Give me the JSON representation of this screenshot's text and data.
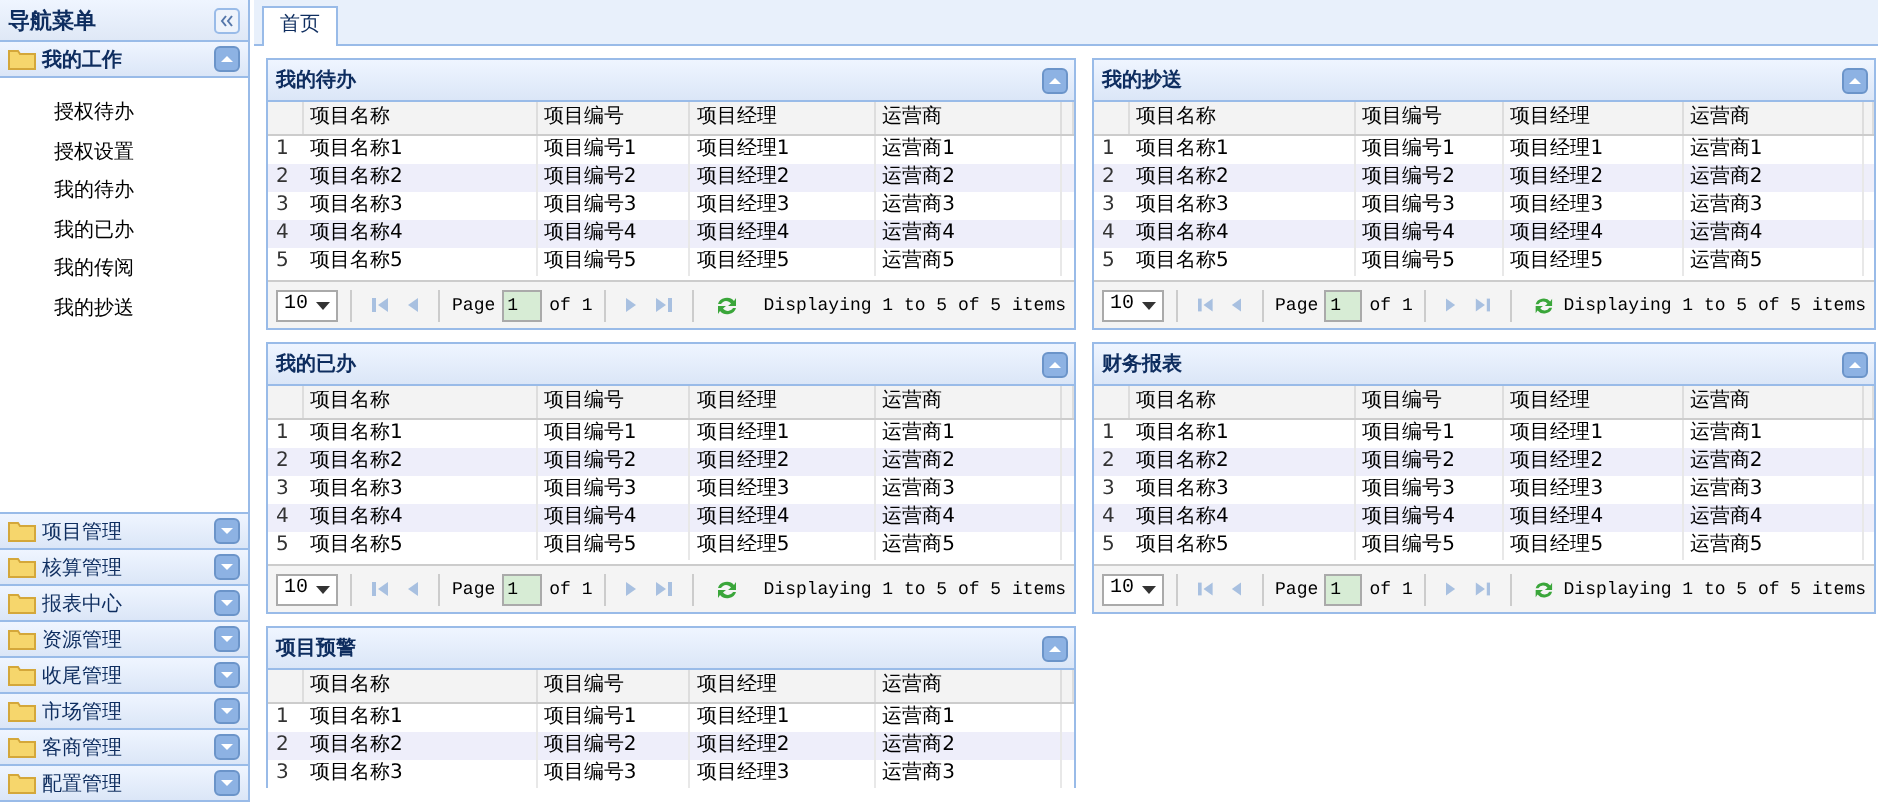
{
  "sidebar": {
    "title": "导航菜单",
    "sections": [
      {
        "label": "我的工作",
        "expanded": true,
        "items": [
          "授权待办",
          "授权设置",
          "我的待办",
          "我的已办",
          "我的传阅",
          "我的抄送"
        ]
      },
      {
        "label": "项目管理",
        "expanded": false
      },
      {
        "label": "核算管理",
        "expanded": false
      },
      {
        "label": "报表中心",
        "expanded": false
      },
      {
        "label": "资源管理",
        "expanded": false
      },
      {
        "label": "收尾管理",
        "expanded": false
      },
      {
        "label": "市场管理",
        "expanded": false
      },
      {
        "label": "客商管理",
        "expanded": false
      },
      {
        "label": "配置管理",
        "expanded": false
      }
    ]
  },
  "tabs": [
    {
      "label": "首页",
      "selected": true
    }
  ],
  "panels": [
    {
      "title": "我的待办",
      "expanded": true,
      "columns": [
        "项目名称",
        "项目编号",
        "项目经理",
        "运营商"
      ],
      "rows": [
        {
          "number": "1",
          "cells": [
            "项目名称1",
            "项目编号1",
            "项目经理1",
            "运营商1"
          ]
        },
        {
          "number": "2",
          "cells": [
            "项目名称2",
            "项目编号2",
            "项目经理2",
            "运营商2"
          ]
        },
        {
          "number": "3",
          "cells": [
            "项目名称3",
            "项目编号3",
            "项目经理3",
            "运营商3"
          ]
        },
        {
          "number": "4",
          "cells": [
            "项目名称4",
            "项目编号4",
            "项目经理4",
            "运营商4"
          ]
        },
        {
          "number": "5",
          "cells": [
            "项目名称5",
            "项目编号5",
            "项目经理5",
            "运营商5"
          ]
        }
      ],
      "pager": {
        "page_size": "10",
        "page_label": "Page",
        "page": "1",
        "of_label": "of 1",
        "summary": "Displaying 1 to 5 of 5 items"
      }
    },
    {
      "title": "我的抄送",
      "expanded": true,
      "columns": [
        "项目名称",
        "项目编号",
        "项目经理",
        "运营商"
      ],
      "rows": [
        {
          "number": "1",
          "cells": [
            "项目名称1",
            "项目编号1",
            "项目经理1",
            "运营商1"
          ]
        },
        {
          "number": "2",
          "cells": [
            "项目名称2",
            "项目编号2",
            "项目经理2",
            "运营商2"
          ]
        },
        {
          "number": "3",
          "cells": [
            "项目名称3",
            "项目编号3",
            "项目经理3",
            "运营商3"
          ]
        },
        {
          "number": "4",
          "cells": [
            "项目名称4",
            "项目编号4",
            "项目经理4",
            "运营商4"
          ]
        },
        {
          "number": "5",
          "cells": [
            "项目名称5",
            "项目编号5",
            "项目经理5",
            "运营商5"
          ]
        }
      ],
      "pager": {
        "page_size": "10",
        "page_label": "Page",
        "page": "1",
        "of_label": "of 1",
        "summary": "Displaying 1 to 5 of 5 items"
      }
    },
    {
      "title": "我的已办",
      "expanded": true,
      "columns": [
        "项目名称",
        "项目编号",
        "项目经理",
        "运营商"
      ],
      "rows": [
        {
          "number": "1",
          "cells": [
            "项目名称1",
            "项目编号1",
            "项目经理1",
            "运营商1"
          ]
        },
        {
          "number": "2",
          "cells": [
            "项目名称2",
            "项目编号2",
            "项目经理2",
            "运营商2"
          ]
        },
        {
          "number": "3",
          "cells": [
            "项目名称3",
            "项目编号3",
            "项目经理3",
            "运营商3"
          ]
        },
        {
          "number": "4",
          "cells": [
            "项目名称4",
            "项目编号4",
            "项目经理4",
            "运营商4"
          ]
        },
        {
          "number": "5",
          "cells": [
            "项目名称5",
            "项目编号5",
            "项目经理5",
            "运营商5"
          ]
        }
      ],
      "pager": {
        "page_size": "10",
        "page_label": "Page",
        "page": "1",
        "of_label": "of 1",
        "summary": "Displaying 1 to 5 of 5 items"
      }
    },
    {
      "title": "财务报表",
      "expanded": true,
      "columns": [
        "项目名称",
        "项目编号",
        "项目经理",
        "运营商"
      ],
      "rows": [
        {
          "number": "1",
          "cells": [
            "项目名称1",
            "项目编号1",
            "项目经理1",
            "运营商1"
          ]
        },
        {
          "number": "2",
          "cells": [
            "项目名称2",
            "项目编号2",
            "项目经理2",
            "运营商2"
          ]
        },
        {
          "number": "3",
          "cells": [
            "项目名称3",
            "项目编号3",
            "项目经理3",
            "运营商3"
          ]
        },
        {
          "number": "4",
          "cells": [
            "项目名称4",
            "项目编号4",
            "项目经理4",
            "运营商4"
          ]
        },
        {
          "number": "5",
          "cells": [
            "项目名称5",
            "项目编号5",
            "项目经理5",
            "运营商5"
          ]
        }
      ],
      "pager": {
        "page_size": "10",
        "page_label": "Page",
        "page": "1",
        "of_label": "of 1",
        "summary": "Displaying 1 to 5 of 5 items"
      }
    },
    {
      "title": "项目预警",
      "expanded": true,
      "columns": [
        "项目名称",
        "项目编号",
        "项目经理",
        "运营商"
      ],
      "rows": [
        {
          "number": "1",
          "cells": [
            "项目名称1",
            "项目编号1",
            "项目经理1",
            "运营商1"
          ]
        },
        {
          "number": "2",
          "cells": [
            "项目名称2",
            "项目编号2",
            "项目经理2",
            "运营商2"
          ]
        },
        {
          "number": "3",
          "cells": [
            "项目名称3",
            "项目编号3",
            "项目经理3",
            "运营商3"
          ]
        }
      ]
    }
  ]
}
